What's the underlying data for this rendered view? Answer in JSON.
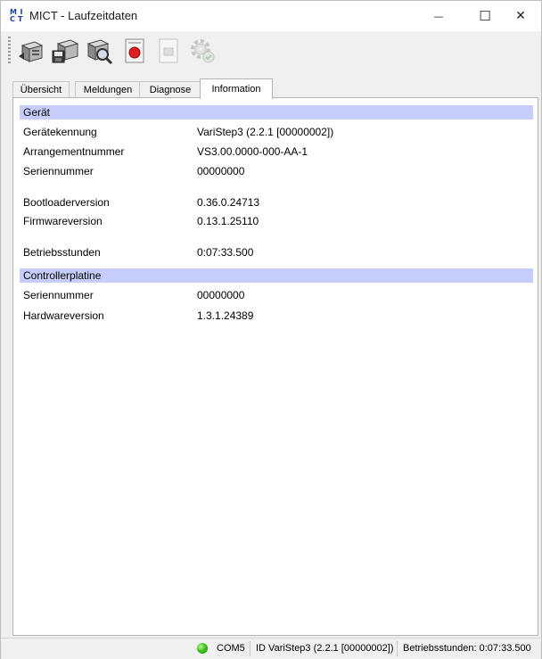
{
  "window": {
    "icon_text": "MI CT",
    "title": "MICT - Laufzeitdaten",
    "minimize_glyph": "—",
    "maximize_glyph": "☐",
    "close_glyph": "✕"
  },
  "toolbar": {
    "buttons": [
      {
        "icon": "device-read-icon"
      },
      {
        "icon": "device-save-icon"
      },
      {
        "icon": "device-search-icon"
      },
      {
        "icon": "record-icon"
      },
      {
        "icon": "document-disabled-icon"
      },
      {
        "icon": "settings-disabled-icon"
      }
    ]
  },
  "tabs": [
    {
      "label": "Übersicht"
    },
    {
      "label": "Meldungen"
    },
    {
      "label": "Diagnose"
    },
    {
      "label": "Information",
      "active": true
    }
  ],
  "info": {
    "section_device": "Gerät",
    "device_id_label": "Gerätekennung",
    "device_id_value": "VariStep3 (2.2.1 [00000002])",
    "arrangement_label": "Arrangementnummer",
    "arrangement_value": "VS3.00.0000-000-AA-1",
    "serial_label": "Seriennummer",
    "serial_value": "00000000",
    "bootloader_label": "Bootloaderversion",
    "bootloader_value": "0.36.0.24713",
    "firmware_label": "Firmwareversion",
    "firmware_value": "0.13.1.25110",
    "hours_label": "Betriebsstunden",
    "hours_value": "0:07:33.500",
    "section_controller": "Controllerplatine",
    "ctrl_serial_label": "Seriennummer",
    "ctrl_serial_value": "00000000",
    "ctrl_hw_label": "Hardwareversion",
    "ctrl_hw_value": "1.3.1.24389"
  },
  "status": {
    "connection_color": "#3fc21a",
    "port": "COM5",
    "device": "ID VariStep3 (2.2.1 [00000002])",
    "hours": "Betriebsstunden: 0:07:33.500"
  },
  "colors": {
    "section_header_bg": "#c6cdfa",
    "window_bg": "#f0f0f0"
  }
}
